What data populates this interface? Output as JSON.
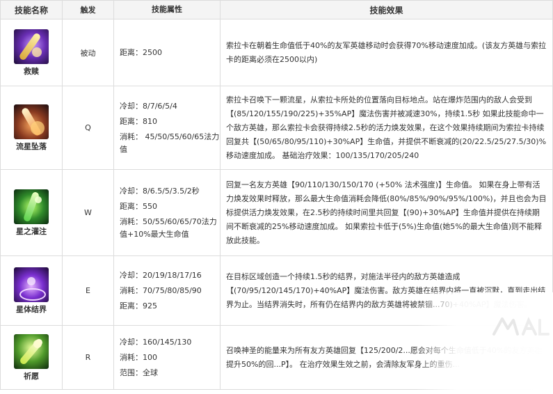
{
  "headers": [
    "技能名称",
    "触发",
    "技能属性",
    "技能效果"
  ],
  "skills": [
    {
      "name": "救赎",
      "trigger": "被动",
      "attrs": [
        "距离：2500"
      ],
      "effect": "索拉卡在朝着生命值低于40%的友军英雄移动时会获得70%移动速度加成。(该友方英雄与索拉卡的距离必须在2500以内)",
      "icon": "redemption-icon"
    },
    {
      "name": "流星坠落",
      "trigger": "Q",
      "attrs": [
        "冷却：8/7/6/5/4",
        "距离：810",
        "消耗： 45/50/55/60/65法力值"
      ],
      "effect": "索拉卡召唤下一颗流星，从索拉卡所处的位置落向目标地点。站在爆炸范围内的敌人会受到【(85/120/155/190/225)+35%AP】魔法伤害并被减速30%，持续1.5秒 如果此技能命中一个敌方英雄，那么索拉卡会获得持续2.5秒的活力焕发效果，在这个效果持续期间为索拉卡持续回复共【(50/65/80/95/110)+30%AP】生命值，并提供不断衰减的(20/22.5/25/27.5/30)%移动速度加成。 基础治疗效果：100/135/170/205/240",
      "icon": "starcall-icon"
    },
    {
      "name": "星之灌注",
      "trigger": "W",
      "attrs": [
        "冷却：8/6.5/5/3.5/2秒",
        "距离：550",
        "消耗：50/55/60/65/70法力值+10%最大生命值"
      ],
      "effect": "回复一名友方英雄【90/110/130/150/170 (+50% 法术强度)】生命值。 如果在身上带有活力焕发效果时释放，那么最大生命值消耗会降低(80%/85%/90%/95%/100%)，并且也会为目标提供活力焕发效果，在2.5秒的持续时间里共回复【(90)+30%AP】生命值并提供在持续期间不断衰减的25%移动速度加成。 如果索拉卡低于(5%)生命值(她5%的最大生命值)则不能释放此技能。",
      "icon": "astral-infusion-icon"
    },
    {
      "name": "星体结界",
      "trigger": "E",
      "attrs": [
        "冷却：20/19/18/17/16",
        "消耗：70/75/80/85/90",
        "距离：925"
      ],
      "effect": "在目标区域创造一个持续1.5秒的结界，对施法半径内的敌方英雄造成【(70/95/120/145/170)+40%AP】魔法伤害。敌方英雄在结界内将一直被沉默，直到走出结界为止。当结界消失时，所有仍在结界内的敌方英雄将被禁锢...70)+40%AP】魔法伤害。",
      "icon": "equinox-icon"
    },
    {
      "name": "祈愿",
      "trigger": "R",
      "attrs": [
        "冷却：160/145/130",
        "消耗：100",
        "范围：全球"
      ],
      "effect": "召唤神圣的能量来为所有友方英雄回复【125/200/2...愿会对每个生命值低于40%的友方英雄提升50%的回...P】。 在治疗效果生效之前，会清除友军身上的重伤...",
      "icon": "wish-icon"
    }
  ],
  "colors": {
    "header_bg": "#f4f4f4",
    "border": "#dcdcdc",
    "text": "#333333"
  }
}
